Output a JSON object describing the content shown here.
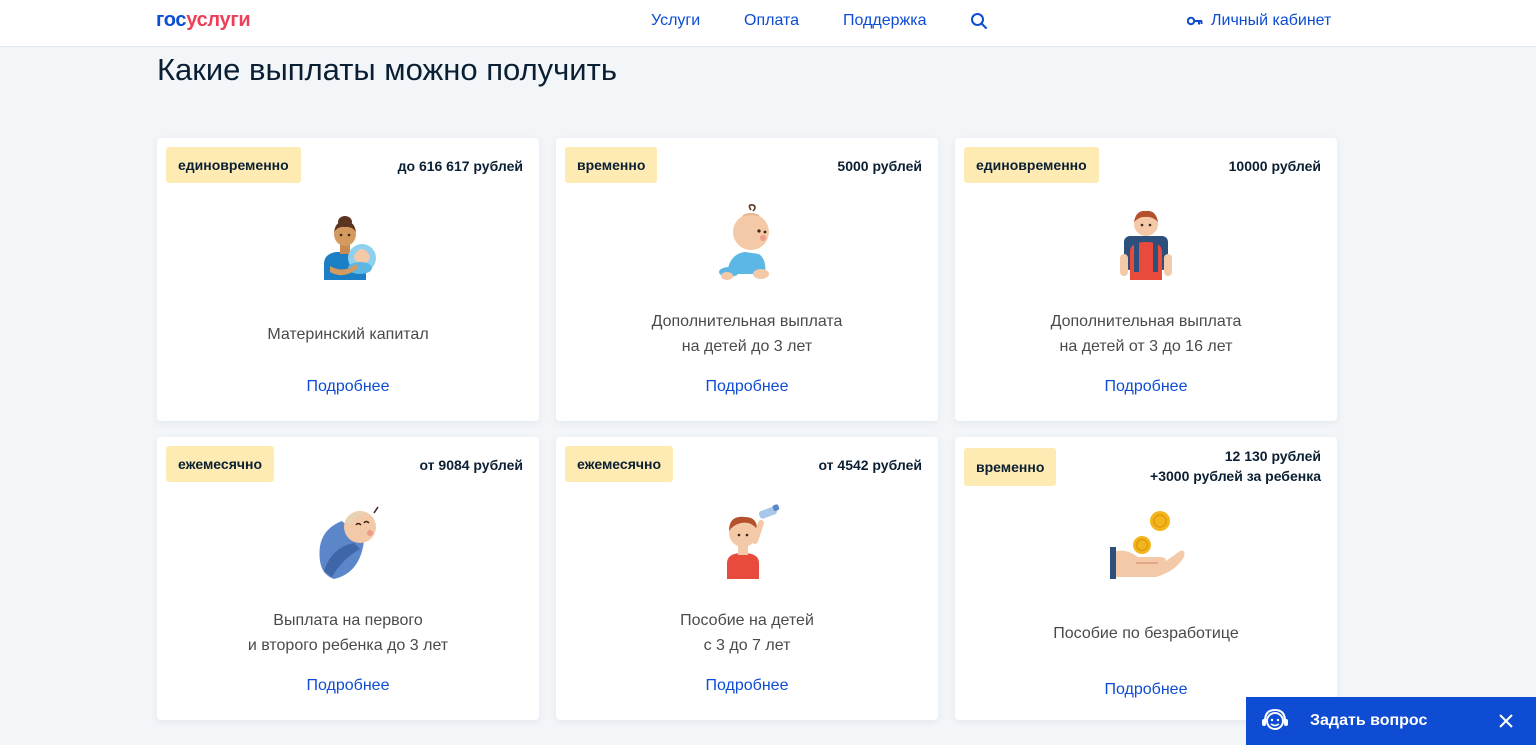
{
  "header": {
    "logo_part1": "гос",
    "logo_part2": "услуги",
    "nav": [
      "Услуги",
      "Оплата",
      "Поддержка"
    ],
    "search_icon": "search-icon",
    "cabinet_label": "Личный кабинет",
    "cabinet_icon": "key-icon"
  },
  "page": {
    "title": "Какие выплаты можно получить"
  },
  "cards": [
    {
      "badge": "единовременно",
      "amount_line1": "до 616 617 рублей",
      "amount_line2": "",
      "title": "Материнский капитал",
      "link": "Подробнее",
      "icon": "mother-with-baby-icon"
    },
    {
      "badge": "временно",
      "amount_line1": "5000 рублей",
      "amount_line2": "",
      "title": "Дополнительная выплата\nна детей до 3 лет",
      "link": "Подробнее",
      "icon": "crawling-baby-icon"
    },
    {
      "badge": "единовременно",
      "amount_line1": "10000 рублей",
      "amount_line2": "",
      "title": "Дополнительная выплата\nна детей от 3 до 16 лет",
      "link": "Подробнее",
      "icon": "schoolboy-icon"
    },
    {
      "badge": "ежемесячно",
      "amount_line1": "от 9084 рублей",
      "amount_line2": "",
      "title": "Выплата на первого\nи второго ребенка до 3 лет",
      "link": "Подробнее",
      "icon": "swaddled-baby-icon"
    },
    {
      "badge": "ежемесячно",
      "amount_line1": "от 4542 рублей",
      "amount_line2": "",
      "title": "Пособие на детей\nс 3 до 7 лет",
      "link": "Подробнее",
      "icon": "child-with-toy-icon"
    },
    {
      "badge": "временно",
      "amount_line1": "12 130 рублей",
      "amount_line2": "+3000 рублей за ребенка",
      "title": "Пособие по безработице",
      "link": "Подробнее",
      "icon": "hand-with-coins-icon"
    }
  ],
  "ask_widget": {
    "label": "Задать вопрос",
    "icon": "support-agent-icon",
    "close_icon": "close-icon"
  },
  "colors": {
    "brand_blue": "#0d4cd3",
    "brand_red": "#ee3f58",
    "badge_bg": "#feebb3",
    "page_bg": "#f3f6f9"
  }
}
